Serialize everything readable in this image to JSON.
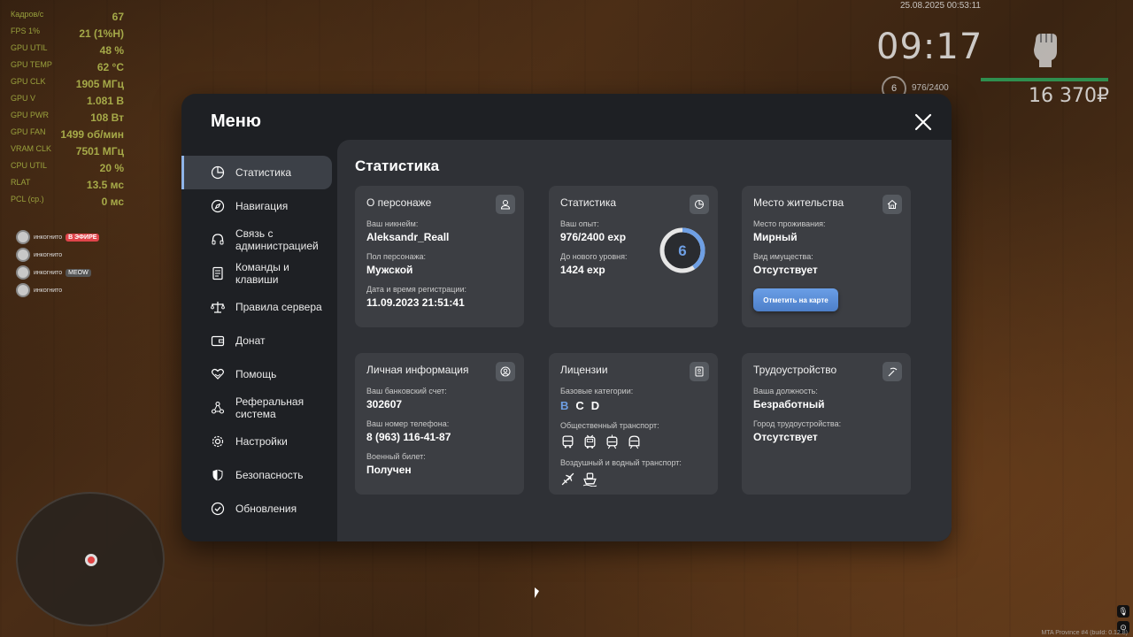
{
  "hud": {
    "stats": [
      {
        "label": "Кадров/с",
        "value": "67"
      },
      {
        "label": "FPS 1%",
        "value": "21 (1%H)"
      },
      {
        "label": "GPU UTIL",
        "value": "48 %"
      },
      {
        "label": "GPU TEMP",
        "value": "62 °C"
      },
      {
        "label": "GPU CLK",
        "value": "1905 МГц"
      },
      {
        "label": "GPU V",
        "value": "1.081 В"
      },
      {
        "label": "GPU PWR",
        "value": "108 Вт"
      },
      {
        "label": "GPU FAN",
        "value": "1499 об/мин"
      },
      {
        "label": "VRAM CLK",
        "value": "7501 МГц"
      },
      {
        "label": "CPU UTIL",
        "value": "20 %"
      },
      {
        "label": "RLAT",
        "value": "13.5 мс"
      },
      {
        "label": "PCL (ср.)",
        "value": "0 мс"
      }
    ],
    "streams": [
      {
        "name": "инкогнито",
        "badge": "В ЭФИРЕ",
        "type": "live"
      },
      {
        "name": "инкогнито",
        "badge": "",
        "type": ""
      },
      {
        "name": "инкогнито",
        "badge": "MEOW",
        "type": "meow"
      },
      {
        "name": "инкогнито",
        "badge": "",
        "type": ""
      }
    ],
    "datetime": "25.08.2025 00:53:11",
    "clock": "09:17",
    "level": "6",
    "exp": "976/2400",
    "money": "16 370₽",
    "health_fraction": 1.0,
    "build": "MTA Province #4 (build: 0.12.8)"
  },
  "menu": {
    "title": "Меню",
    "close_icon": "close-icon",
    "nav": [
      {
        "id": "stats",
        "label": "Статистика",
        "icon": "pie-chart-icon",
        "active": true
      },
      {
        "id": "navigation",
        "label": "Навигация",
        "icon": "compass-icon",
        "active": false
      },
      {
        "id": "admin",
        "label": "Связь с\nадминистрацией",
        "icon": "headset-icon",
        "active": false
      },
      {
        "id": "commands",
        "label": "Команды и\nклавиши",
        "icon": "document-icon",
        "active": false
      },
      {
        "id": "rules",
        "label": "Правила сервера",
        "icon": "scales-icon",
        "active": false
      },
      {
        "id": "donate",
        "label": "Донат",
        "icon": "wallet-icon",
        "active": false
      },
      {
        "id": "help",
        "label": "Помощь",
        "icon": "heart-hands-icon",
        "active": false
      },
      {
        "id": "referral",
        "label": "Реферальная\nсистема",
        "icon": "network-icon",
        "active": false
      },
      {
        "id": "settings",
        "label": "Настройки",
        "icon": "gear-icon",
        "active": false
      },
      {
        "id": "security",
        "label": "Безопасность",
        "icon": "shield-icon",
        "active": false
      },
      {
        "id": "updates",
        "label": "Обновления",
        "icon": "check-circle-icon",
        "active": false
      }
    ]
  },
  "content": {
    "title": "Статистика",
    "character": {
      "title": "О персонаже",
      "nickname_label": "Ваш никнейм:",
      "nickname": "Aleksandr_Reall",
      "gender_label": "Пол персонажа:",
      "gender": "Мужской",
      "reg_label": "Дата и время регистрации:",
      "reg": "11.09.2023 21:51:41"
    },
    "stats": {
      "title": "Статистика",
      "exp_label": "Ваш опыт:",
      "exp": "976/2400 exp",
      "next_label": "До нового уровня:",
      "next": "1424 exp",
      "level": "6",
      "progress": 0.4067
    },
    "residence": {
      "title": "Место жительства",
      "place_label": "Место проживания:",
      "place": "Мирный",
      "property_label": "Вид имущества:",
      "property": "Отсутствует",
      "map_button": "Отметить на карте"
    },
    "personal": {
      "title": "Личная информация",
      "bank_label": "Ваш банковский счет:",
      "bank": "302607",
      "phone_label": "Ваш номер телефона:",
      "phone": "8 (963) 116-41-87",
      "military_label": "Военный билет:",
      "military": "Получен"
    },
    "licenses": {
      "title": "Лицензии",
      "base_label": "Базовые категории:",
      "categories": [
        {
          "label": "B",
          "active": true
        },
        {
          "label": "C",
          "active": false
        },
        {
          "label": "D",
          "active": false
        }
      ],
      "public_label": "Общественный транспорт:",
      "public_icons": [
        "bus-icon",
        "trolleybus-icon",
        "tram-icon",
        "metro-icon"
      ],
      "air_label": "Воздушный и водный транспорт:",
      "air_icons": [
        "airplane-icon",
        "ship-icon"
      ]
    },
    "employment": {
      "title": "Трудоустройство",
      "position_label": "Ваша должность:",
      "position": "Безработный",
      "city_label": "Город трудоустройства:",
      "city": "Отсутствует"
    }
  }
}
